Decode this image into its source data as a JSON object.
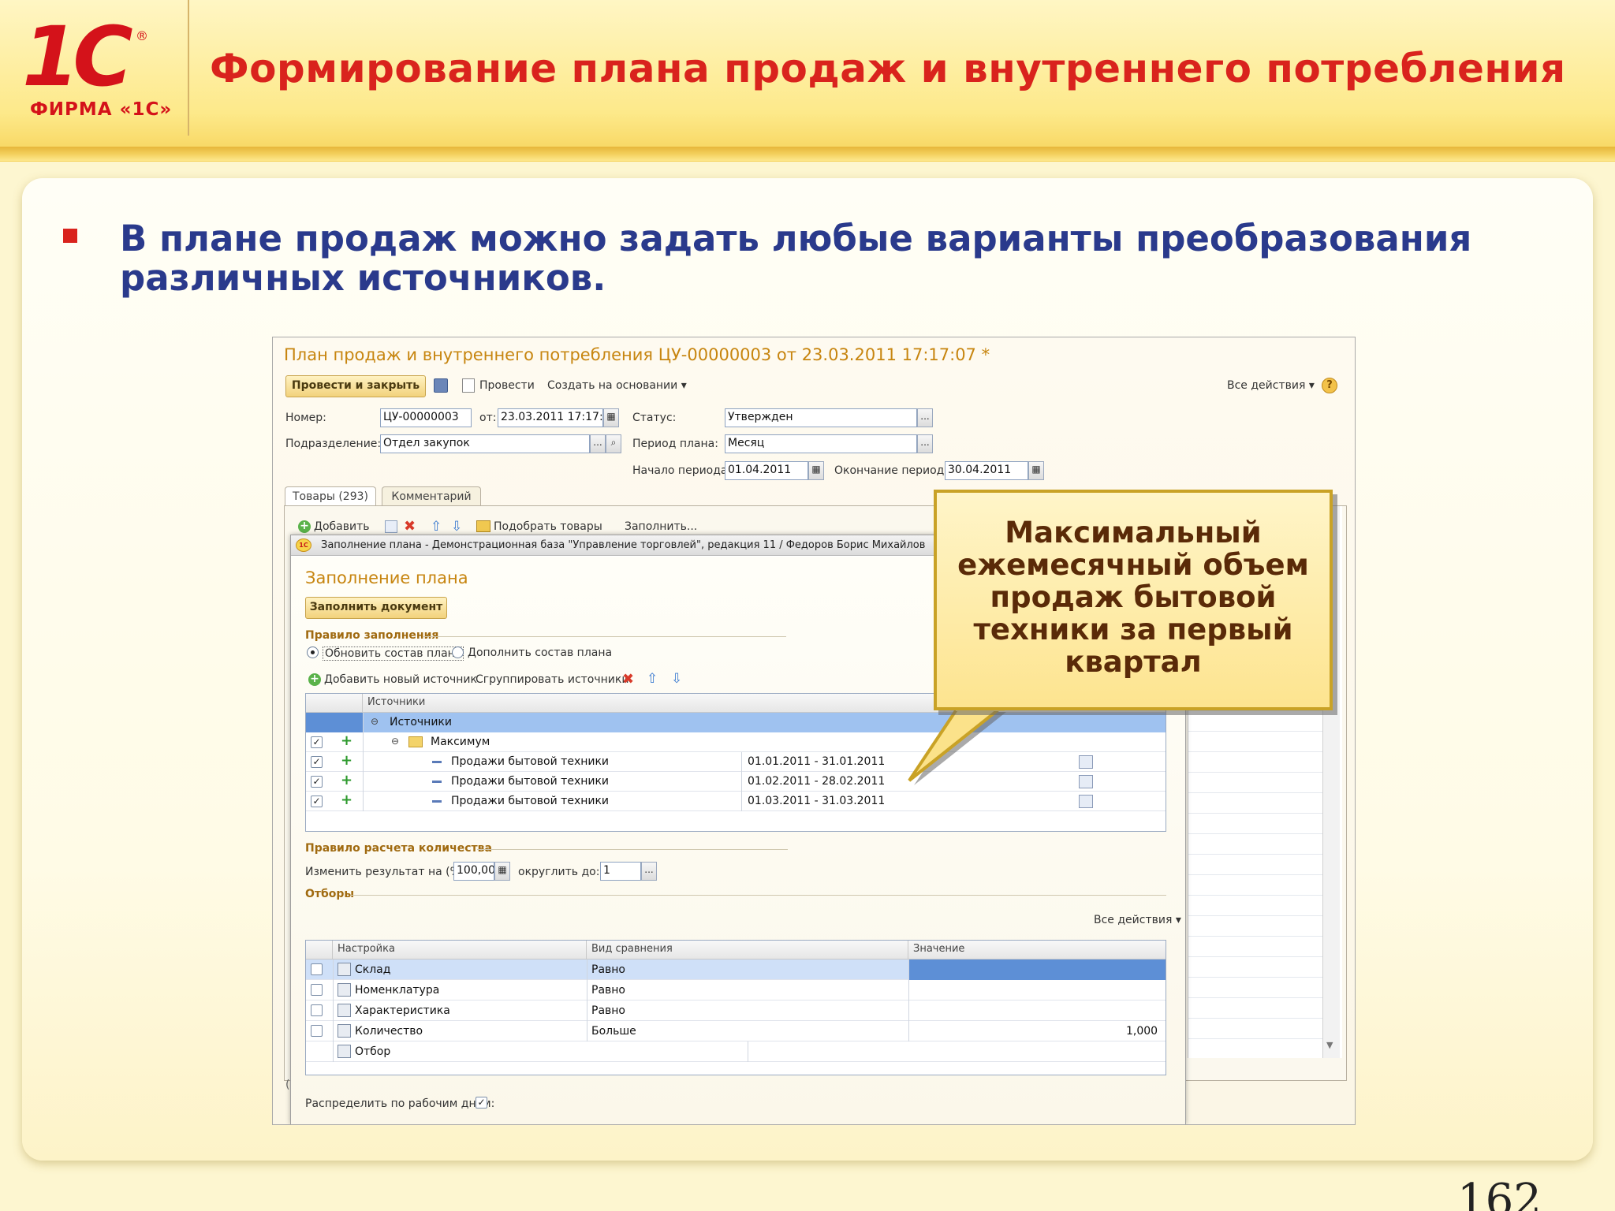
{
  "slide": {
    "title": "Формирование плана продаж и внутреннего потребления",
    "logo_text": "1С",
    "logo_registered": "®",
    "logo_firm": "ФИРМА «1С»",
    "bullet_text": "В плане продаж можно задать любые варианты преобразования различных источников.",
    "page_number": "162",
    "colors": {
      "title": "#d9231d",
      "bullet": "#2a3a8c",
      "accent": "#f6d257"
    }
  },
  "window": {
    "title": "План продаж и внутреннего потребления ЦУ-00000003 от 23.03.2011 17:17:07 *",
    "toolbar": {
      "post_close": "Провести и закрыть",
      "post": "Провести",
      "create_based": "Создать на основании ▾",
      "all_actions": "Все действия ▾",
      "help": "?"
    },
    "fields": {
      "number_label": "Номер:",
      "number_value": "ЦУ-00000003",
      "date_label": "от:",
      "date_value": "23.03.2011 17:17:07",
      "status_label": "Статус:",
      "status_value": "Утвержден",
      "division_label": "Подразделение:",
      "division_value": "Отдел закупок",
      "period_label": "Период плана:",
      "period_value": "Месяц",
      "start_label": "Начало периода:",
      "start_value": "01.04.2011",
      "end_label": "Окончание периода:",
      "end_value": "30.04.2011"
    },
    "tabs": [
      {
        "label": "Товары (293)"
      },
      {
        "label": "Комментарий"
      }
    ],
    "goods_toolbar": {
      "add": "Добавить",
      "pick": "Подобрать товары",
      "fill": "Заполнить..."
    },
    "partial_char": "("
  },
  "dialog": {
    "title": "Заполнение плана - Демонстрационная база \"Управление торговлей\", редакция 11 / Федоров Борис Михайлов",
    "heading": "Заполнение плана",
    "fill_button": "Заполнить документ",
    "fill_rule_label": "Правило заполнения",
    "radio_update": "Обновить состав плана",
    "radio_append": "Дополнить состав плана",
    "add_source": "Добавить новый источник",
    "group_sources": "Сгруппировать источники",
    "sources_header": "Источники",
    "sources_root": "Источники",
    "sources_group": "Максимум",
    "sources_rows": [
      {
        "name": "Продажи бытовой техники",
        "period": "01.01.2011 - 31.01.2011"
      },
      {
        "name": "Продажи бытовой техники",
        "period": "01.02.2011 - 28.02.2011"
      },
      {
        "name": "Продажи бытовой техники",
        "period": "01.03.2011 - 31.03.2011"
      }
    ],
    "qty_rule_label": "Правило расчета количества",
    "change_result_label": "Изменить результат на (%):",
    "change_result_value": "100,00",
    "round_label": "округлить до:",
    "round_value": "1",
    "filters_label": "Отборы",
    "all_actions": "Все действия ▾",
    "filters_headers": [
      "Настройка",
      "Вид сравнения",
      "Значение"
    ],
    "filters_rows": [
      {
        "setting": "Склад",
        "compare": "Равно",
        "value": ""
      },
      {
        "setting": "Номенклатура",
        "compare": "Равно",
        "value": ""
      },
      {
        "setting": "Характеристика",
        "compare": "Равно",
        "value": ""
      },
      {
        "setting": "Количество",
        "compare": "Больше",
        "value": "1,000"
      },
      {
        "setting": "Отбор",
        "compare": "",
        "value": ""
      }
    ],
    "distribute_label": "Распределить по рабочим дням:"
  },
  "callout": {
    "text": "Максимальный ежемесячный объем продаж бытовой техники за первый квартал"
  }
}
